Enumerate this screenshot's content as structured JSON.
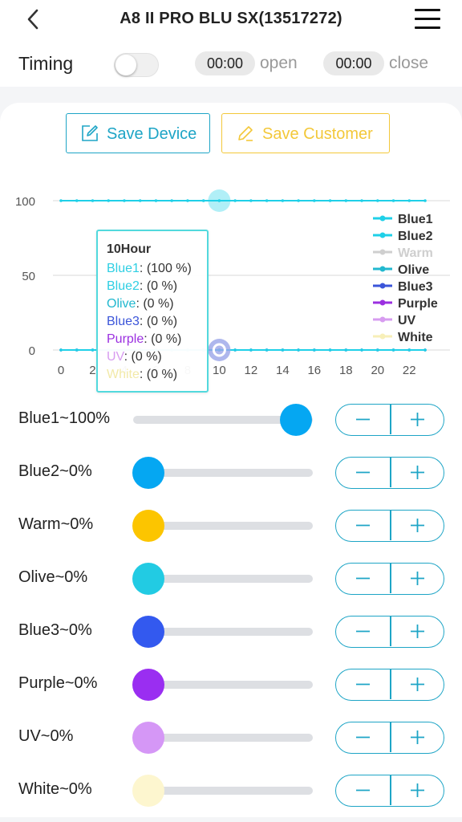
{
  "header": {
    "title": "A8 II PRO BLU SX(13517272)"
  },
  "timing": {
    "label": "Timing",
    "enabled": false,
    "open_time": "00:00",
    "open_label": "open",
    "close_time": "00:00",
    "close_label": "close"
  },
  "actions": {
    "save_device": "Save Device",
    "save_customer": "Save Customer"
  },
  "chart_data": {
    "type": "line",
    "x": [
      0,
      1,
      2,
      3,
      4,
      5,
      6,
      7,
      8,
      9,
      10,
      11,
      12,
      13,
      14,
      15,
      16,
      17,
      18,
      19,
      20,
      21,
      22,
      23
    ],
    "x_ticks": [
      "0",
      "2",
      "4",
      "6",
      "8",
      "10",
      "12",
      "14",
      "16",
      "18",
      "20",
      "22"
    ],
    "y_ticks": [
      "0",
      "50",
      "100"
    ],
    "ylim": [
      0,
      100
    ],
    "grid": true,
    "legend_position": "right",
    "highlighted_x": 10,
    "series": [
      {
        "name": "Blue1",
        "color": "#1fd0e8",
        "legend_color": "#1fd0e8",
        "values": [
          100,
          100,
          100,
          100,
          100,
          100,
          100,
          100,
          100,
          100,
          100,
          100,
          100,
          100,
          100,
          100,
          100,
          100,
          100,
          100,
          100,
          100,
          100,
          100
        ]
      },
      {
        "name": "Blue2",
        "color": "#1fd0e8",
        "legend_color": "#1fd0e8",
        "values": [
          0,
          0,
          0,
          0,
          0,
          0,
          0,
          0,
          0,
          0,
          0,
          0,
          0,
          0,
          0,
          0,
          0,
          0,
          0,
          0,
          0,
          0,
          0,
          0
        ]
      },
      {
        "name": "Warm",
        "color": "#cfcfcf",
        "legend_color": "#cfcfcf",
        "values": [
          0,
          0,
          0,
          0,
          0,
          0,
          0,
          0,
          0,
          0,
          0,
          0,
          0,
          0,
          0,
          0,
          0,
          0,
          0,
          0,
          0,
          0,
          0,
          0
        ]
      },
      {
        "name": "Olive",
        "color": "#22b8cf",
        "legend_color": "#22b8cf",
        "values": [
          0,
          0,
          0,
          0,
          0,
          0,
          0,
          0,
          0,
          0,
          0,
          0,
          0,
          0,
          0,
          0,
          0,
          0,
          0,
          0,
          0,
          0,
          0,
          0
        ]
      },
      {
        "name": "Blue3",
        "color": "#3b55d9",
        "legend_color": "#3b55d9",
        "values": [
          0,
          0,
          0,
          0,
          0,
          0,
          0,
          0,
          0,
          0,
          0,
          0,
          0,
          0,
          0,
          0,
          0,
          0,
          0,
          0,
          0,
          0,
          0,
          0
        ]
      },
      {
        "name": "Purple",
        "color": "#9b30e0",
        "legend_color": "#9b30e0",
        "values": [
          0,
          0,
          0,
          0,
          0,
          0,
          0,
          0,
          0,
          0,
          0,
          0,
          0,
          0,
          0,
          0,
          0,
          0,
          0,
          0,
          0,
          0,
          0,
          0
        ]
      },
      {
        "name": "UV",
        "color": "#d79cf0",
        "legend_color": "#d79cf0",
        "values": [
          0,
          0,
          0,
          0,
          0,
          0,
          0,
          0,
          0,
          0,
          0,
          0,
          0,
          0,
          0,
          0,
          0,
          0,
          0,
          0,
          0,
          0,
          0,
          0
        ]
      },
      {
        "name": "White",
        "color": "#f7efb8",
        "legend_color": "#f7efb8",
        "values": [
          0,
          0,
          0,
          0,
          0,
          0,
          0,
          0,
          0,
          0,
          0,
          0,
          0,
          0,
          0,
          0,
          0,
          0,
          0,
          0,
          0,
          0,
          0,
          0
        ]
      }
    ]
  },
  "tooltip": {
    "title": "10Hour",
    "rows": [
      {
        "name": "Blue1",
        "value": ": (100 %)",
        "color": "#2ecfe3"
      },
      {
        "name": "Blue2",
        "value": ": (0 %)",
        "color": "#2ecfe3"
      },
      {
        "name": "Olive",
        "value": ": (0 %)",
        "color": "#22b8cf"
      },
      {
        "name": "Blue3",
        "value": ": (0 %)",
        "color": "#3b55d9"
      },
      {
        "name": "Purple",
        "value": ": (0 %)",
        "color": "#9b30e0"
      },
      {
        "name": "UV",
        "value": ": (0 %)",
        "color": "#d79cf0"
      },
      {
        "name": "White",
        "value": ": (0 %)",
        "color": "#f2e9a8"
      }
    ]
  },
  "channels": [
    {
      "label": "Blue1~100%",
      "value": 100,
      "color": "#05a7f2"
    },
    {
      "label": "Blue2~0%",
      "value": 0,
      "color": "#05a7f2"
    },
    {
      "label": "Warm~0%",
      "value": 0,
      "color": "#fcc500"
    },
    {
      "label": "Olive~0%",
      "value": 0,
      "color": "#22cbe3"
    },
    {
      "label": "Blue3~0%",
      "value": 0,
      "color": "#3359ef"
    },
    {
      "label": "Purple~0%",
      "value": 0,
      "color": "#9a2ef1"
    },
    {
      "label": "UV~0%",
      "value": 0,
      "color": "#d597f6"
    },
    {
      "label": "White~0%",
      "value": 0,
      "color": "#fdf6cf"
    }
  ],
  "stepper": {
    "minus_icon": "minus-icon",
    "plus_icon": "plus-icon"
  }
}
